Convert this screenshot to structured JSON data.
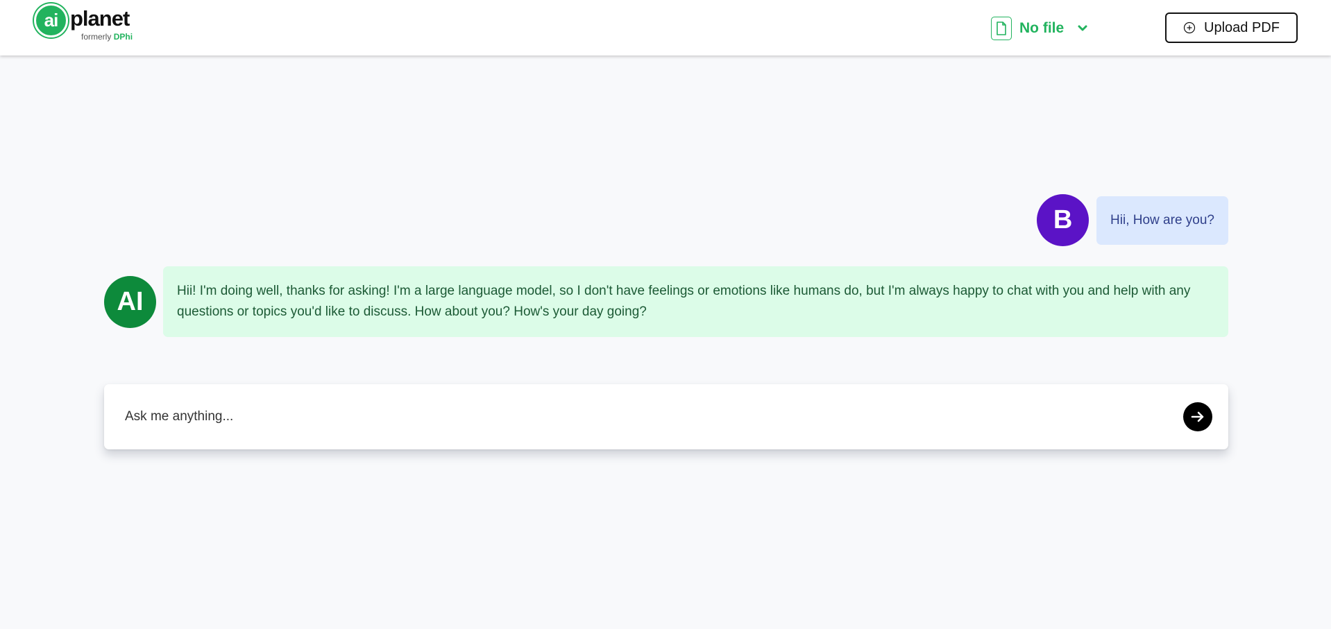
{
  "header": {
    "logo": {
      "mark_text": "ai",
      "wordmark": "planet",
      "tagline_prefix": "formerly",
      "tagline_brand": "DPhi"
    },
    "file_select": {
      "icon": "file-icon",
      "selected": "No file",
      "chevron_icon": "chevron-down-icon"
    },
    "upload_button": {
      "icon": "plus-circle-icon",
      "label": "Upload PDF"
    }
  },
  "chat": {
    "messages": [
      {
        "role": "user",
        "avatar_text": "B",
        "text": "Hii, How are you?"
      },
      {
        "role": "ai",
        "avatar_text": "AI",
        "text": "Hii! I'm doing well, thanks for asking! I'm a large language model, so I don't have feelings or emotions like humans do, but I'm always happy to chat with you and help with any questions or topics you'd like to discuss. How about you? How's your day going?"
      }
    ]
  },
  "composer": {
    "placeholder": "Ask me anything...",
    "value": "",
    "send_icon": "arrow-right-icon"
  },
  "colors": {
    "brand_green": "#22b35e",
    "ai_avatar": "#0d8a3b",
    "user_avatar": "#5b13c6",
    "user_bubble": "#dbe8fe",
    "ai_bubble": "#dcfce8",
    "background": "#f8f9fb"
  }
}
